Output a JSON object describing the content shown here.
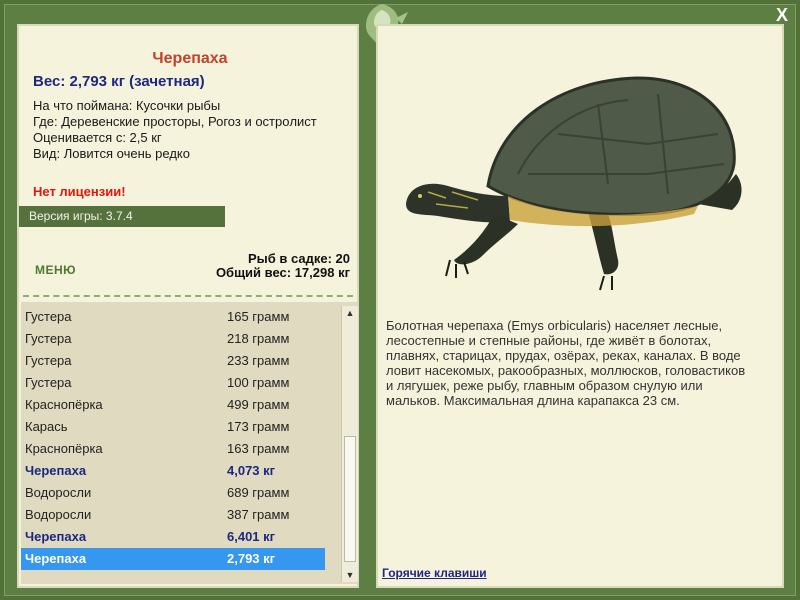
{
  "window": {
    "close_label": "X"
  },
  "catch": {
    "title": "Черепаха",
    "weight": "Вес: 2,793 кг (зачетная)",
    "caught_on": "На что поймана: Кусочки рыбы",
    "location": "Где: Деревенские просторы, Рогоз и острoлист",
    "valued_from": "Оценивается с: 2,5 кг",
    "kind": "Вид: Ловится очень редко",
    "license_warning": "Нет лицензии!"
  },
  "version": "Версия игры: 3.7.4",
  "menu_label": "МЕНЮ",
  "tank": {
    "count": "Рыб в садке: 20",
    "total_weight": "Общий вес: 17,298 кг"
  },
  "fish_list": [
    {
      "name": "Густера",
      "weight": "165 грамм",
      "style": "normal"
    },
    {
      "name": "Густера",
      "weight": "218 грамм",
      "style": "normal"
    },
    {
      "name": "Густера",
      "weight": "233 грамм",
      "style": "normal"
    },
    {
      "name": "Густера",
      "weight": "100 грамм",
      "style": "normal"
    },
    {
      "name": "Краснопёрка",
      "weight": "499 грамм",
      "style": "normal"
    },
    {
      "name": "Карась",
      "weight": "173 грамм",
      "style": "normal"
    },
    {
      "name": "Краснопёрка",
      "weight": "163 грамм",
      "style": "normal"
    },
    {
      "name": "Черепаха",
      "weight": "4,073 кг",
      "style": "bold"
    },
    {
      "name": "Водоросли",
      "weight": "689 грамм",
      "style": "normal"
    },
    {
      "name": "Водоросли",
      "weight": "387 грамм",
      "style": "normal"
    },
    {
      "name": "Черепаха",
      "weight": "6,401 кг",
      "style": "bold"
    },
    {
      "name": "Черепаха",
      "weight": "2,793 кг",
      "style": "selected"
    }
  ],
  "description": "Болотная черепаха (Emys orbicularis) населяет лесные, лесостепные и степные районы, где живёт в болотах, плавнях, старицах, прудах, озёрах, реках, каналах. В воде ловит насекомых, ракообразных, моллюсков, головастиков и лягушек, реже рыбу, главным образом снулую или мальков. Максимальная длина карапакса 23 см.",
  "hotkeys_label": "Горячие клавиши",
  "colors": {
    "frame": "#52723a",
    "panel": "#f5f3dc",
    "title": "#c0432a",
    "navy": "#1d2782",
    "warning": "#e2170f",
    "selection": "#3597f0"
  }
}
